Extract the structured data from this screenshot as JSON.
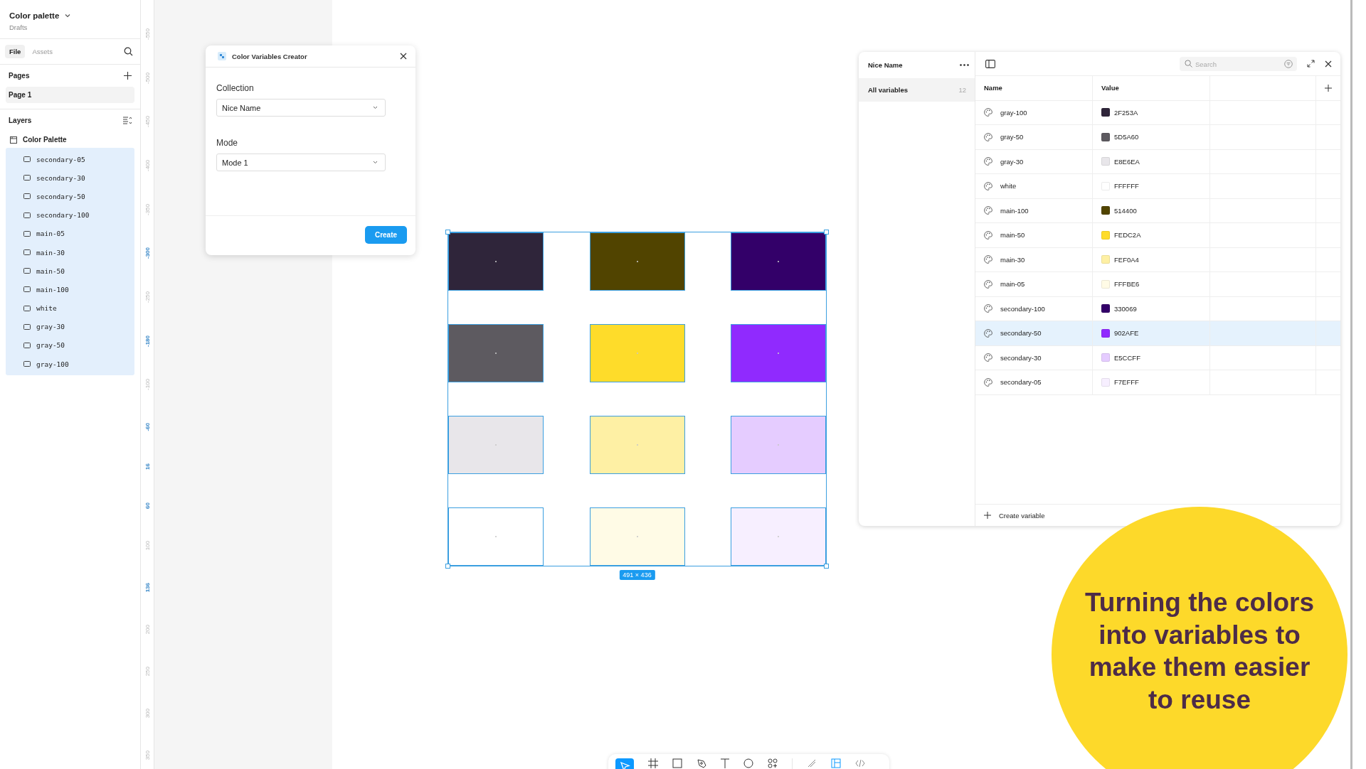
{
  "file": {
    "name": "Color palette",
    "location": "Drafts"
  },
  "sidebar_tabs": [
    {
      "label": "File",
      "selected": true
    },
    {
      "label": "Assets",
      "selected": false
    }
  ],
  "pages": {
    "title": "Pages",
    "items": [
      {
        "label": "Page 1",
        "selected": true
      }
    ]
  },
  "layers": {
    "title": "Layers",
    "frame": "Color Palette",
    "items": [
      {
        "label": "secondary-05",
        "selected": true
      },
      {
        "label": "secondary-30",
        "selected": true
      },
      {
        "label": "secondary-50",
        "selected": true
      },
      {
        "label": "secondary-100",
        "selected": true
      },
      {
        "label": "main-05",
        "selected": true
      },
      {
        "label": "main-30",
        "selected": true
      },
      {
        "label": "main-50",
        "selected": true
      },
      {
        "label": "main-100",
        "selected": true
      },
      {
        "label": "white",
        "selected": true
      },
      {
        "label": "gray-30",
        "selected": true
      },
      {
        "label": "gray-50",
        "selected": true
      },
      {
        "label": "gray-100",
        "selected": true
      }
    ]
  },
  "ruler": [
    {
      "label": "-550",
      "highlighted": false
    },
    {
      "label": "-500",
      "highlighted": false
    },
    {
      "label": "-450",
      "highlighted": false
    },
    {
      "label": "-400",
      "highlighted": false
    },
    {
      "label": "-350",
      "highlighted": false
    },
    {
      "label": "-300",
      "highlighted": true
    },
    {
      "label": "-250",
      "highlighted": false
    },
    {
      "label": "-180",
      "highlighted": true
    },
    {
      "label": "-100",
      "highlighted": false
    },
    {
      "label": "-60",
      "highlighted": true
    },
    {
      "label": "16",
      "highlighted": true
    },
    {
      "label": "60",
      "highlighted": true
    },
    {
      "label": "100",
      "highlighted": false
    },
    {
      "label": "136",
      "highlighted": true
    },
    {
      "label": "200",
      "highlighted": false
    },
    {
      "label": "250",
      "highlighted": false
    },
    {
      "label": "300",
      "highlighted": false
    },
    {
      "label": "350",
      "highlighted": false
    }
  ],
  "canvas": {
    "size_badge": "491 × 436",
    "swatches": [
      [
        {
          "color": "#2f253a"
        },
        {
          "color": "#514400"
        },
        {
          "color": "#330069"
        }
      ],
      [
        {
          "color": "#5d5a60"
        },
        {
          "color": "#fedc2a"
        },
        {
          "color": "#902afe"
        }
      ],
      [
        {
          "color": "#e8e6ea"
        },
        {
          "color": "#fef0a4"
        },
        {
          "color": "#e5ccff"
        }
      ],
      [
        {
          "color": "#ffffff"
        },
        {
          "color": "#fffbe6"
        },
        {
          "color": "#f7efff"
        }
      ]
    ]
  },
  "dialog": {
    "title": "Color Variables Creator",
    "fields": [
      {
        "label": "Collection",
        "value": "Nice Name"
      },
      {
        "label": "Mode",
        "value": "Mode 1"
      }
    ],
    "button": "Create"
  },
  "variables": {
    "collection": "Nice Name",
    "groups": [
      {
        "label": "All variables",
        "count": "12",
        "selected": true
      }
    ],
    "search": {
      "placeholder": "Search"
    },
    "columns": [
      "Name",
      "Value"
    ],
    "rows": [
      {
        "name": "gray-100",
        "value": "2F253A",
        "color": "#2f253a",
        "selected": false
      },
      {
        "name": "gray-50",
        "value": "5D5A60",
        "color": "#5d5a60",
        "selected": false
      },
      {
        "name": "gray-30",
        "value": "E8E6EA",
        "color": "#e8e6ea",
        "selected": false
      },
      {
        "name": "white",
        "value": "FFFFFF",
        "color": "#ffffff",
        "selected": false
      },
      {
        "name": "main-100",
        "value": "514400",
        "color": "#514400",
        "selected": false
      },
      {
        "name": "main-50",
        "value": "FEDC2A",
        "color": "#fedc2a",
        "selected": false
      },
      {
        "name": "main-30",
        "value": "FEF0A4",
        "color": "#fef0a4",
        "selected": false
      },
      {
        "name": "main-05",
        "value": "FFFBE6",
        "color": "#fffbe6",
        "selected": false
      },
      {
        "name": "secondary-100",
        "value": "330069",
        "color": "#330069",
        "selected": false
      },
      {
        "name": "secondary-50",
        "value": "902AFE",
        "color": "#902afe",
        "selected": true
      },
      {
        "name": "secondary-30",
        "value": "E5CCFF",
        "color": "#e5ccff",
        "selected": false
      },
      {
        "name": "secondary-05",
        "value": "F7EFFF",
        "color": "#f7efff",
        "selected": false
      }
    ],
    "create_label": "Create variable"
  },
  "callout": {
    "text": "Turning the colors into variables to make them easier to reuse"
  }
}
